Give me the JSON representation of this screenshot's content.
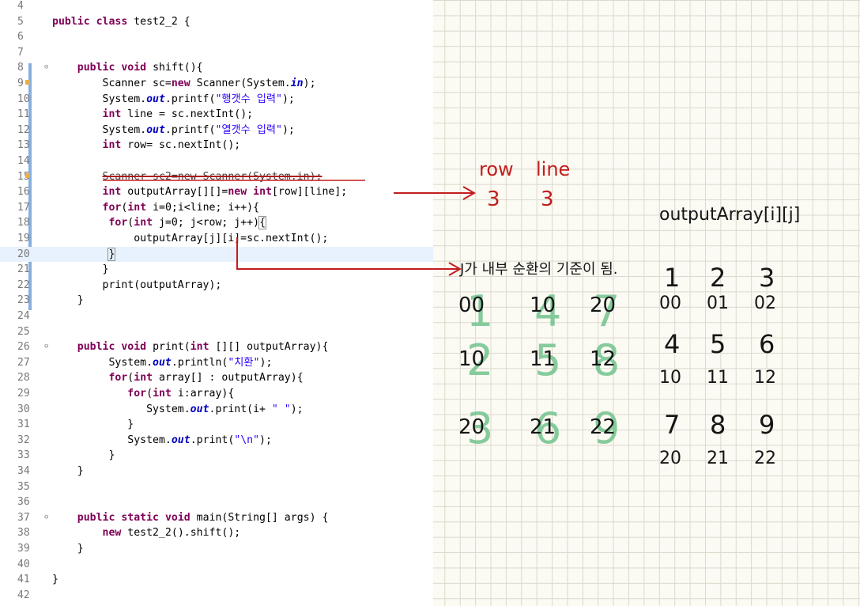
{
  "editor": {
    "lines": [
      {
        "n": "4",
        "html": ""
      },
      {
        "n": "5",
        "html": "<span class='kw'>public</span> <span class='kw'>class</span> test2_2 {"
      },
      {
        "n": "6",
        "html": ""
      },
      {
        "n": "7",
        "html": ""
      },
      {
        "n": "8",
        "marker": "⊖",
        "html": "    <span class='kw'>public</span> <span class='kw'>void</span> shift(){"
      },
      {
        "n": "9",
        "warn": true,
        "html": "        Scanner sc=<span class='kw'>new</span> Scanner(System.<span class='fld'>in</span>);"
      },
      {
        "n": "10",
        "html": "        System.<span class='fld'>out</span>.printf(<span class='str'>\"행갯수 입력\"</span>);"
      },
      {
        "n": "11",
        "html": "        <span class='kw'>int</span> line = sc.nextInt();"
      },
      {
        "n": "12",
        "html": "        System.<span class='fld'>out</span>.printf(<span class='str'>\"열갯수 입력\"</span>);"
      },
      {
        "n": "13",
        "html": "        <span class='kw'>int</span> row= sc.nextInt();"
      },
      {
        "n": "14",
        "html": ""
      },
      {
        "n": "15",
        "warn": true,
        "html": "        <span class='strike'>Scanner sc2=new Scanner(System.in);</span>"
      },
      {
        "n": "16",
        "html": "        <span class='kw'>int</span> outputArray[][]=<span class='kw'>new</span> <span class='kw'>int</span>[row][line];"
      },
      {
        "n": "17",
        "html": "        <span class='kw'>for</span>(<span class='kw'>int</span> i=0;i&lt;line; i++){"
      },
      {
        "n": "18",
        "html": "         <span class='kw'>for</span>(<span class='kw'>int</span> j=0; j&lt;row; j++)<span class='bracket'>{</span>"
      },
      {
        "n": "19",
        "html": "             outputArray[j][i]=sc.nextInt();"
      },
      {
        "n": "20",
        "current": true,
        "html": "         <span class='bracket'>}</span>"
      },
      {
        "n": "21",
        "html": "        }"
      },
      {
        "n": "22",
        "html": "        print(outputArray);"
      },
      {
        "n": "23",
        "html": "    }"
      },
      {
        "n": "24",
        "html": ""
      },
      {
        "n": "25",
        "html": ""
      },
      {
        "n": "26",
        "marker": "⊖",
        "html": "    <span class='kw'>public</span> <span class='kw'>void</span> print(<span class='kw'>int</span> [][] outputArray){"
      },
      {
        "n": "27",
        "html": "         System.<span class='fld'>out</span>.println(<span class='str'>\"치환\"</span>);"
      },
      {
        "n": "28",
        "html": "         <span class='kw'>for</span>(<span class='kw'>int</span> array[] : outputArray){"
      },
      {
        "n": "29",
        "html": "            <span class='kw'>for</span>(<span class='kw'>int</span> i:array){"
      },
      {
        "n": "30",
        "html": "               System.<span class='fld'>out</span>.print(i+ <span class='str'>\" \"</span>);"
      },
      {
        "n": "31",
        "html": "            }"
      },
      {
        "n": "32",
        "html": "            System.<span class='fld'>out</span>.print(<span class='str'>\"\\n\"</span>);"
      },
      {
        "n": "33",
        "html": "         }"
      },
      {
        "n": "34",
        "html": "    }"
      },
      {
        "n": "35",
        "html": ""
      },
      {
        "n": "36",
        "html": ""
      },
      {
        "n": "37",
        "marker": "⊖",
        "html": "    <span class='kw'>public</span> <span class='kw'>static</span> <span class='kw'>void</span> main(String[] args) {"
      },
      {
        "n": "38",
        "html": "        <span class='kw'>new</span> test2_2().shift();"
      },
      {
        "n": "39",
        "html": "    }"
      },
      {
        "n": "40",
        "html": ""
      },
      {
        "n": "41",
        "html": "}"
      },
      {
        "n": "42",
        "html": ""
      }
    ]
  },
  "notes": {
    "row_label": "row",
    "line_label": "line",
    "row_value": "3",
    "line_value": "3",
    "array_title": "outputArray[i][j]",
    "korean_note": "J가 내부 순환의 기준이 됨.",
    "left_grid": [
      [
        "00",
        "10",
        "20"
      ],
      [
        "10",
        "11",
        "12"
      ],
      [
        "20",
        "21",
        "22"
      ]
    ],
    "green_overlay": [
      [
        "1",
        "4",
        "7"
      ],
      [
        "2",
        "5",
        "8"
      ],
      [
        "3",
        "6",
        "9"
      ]
    ],
    "right_values": [
      [
        "1",
        "2",
        "3"
      ],
      [
        "4",
        "5",
        "6"
      ],
      [
        "7",
        "8",
        "9"
      ]
    ],
    "right_indices": [
      [
        "00",
        "01",
        "02"
      ],
      [
        "10",
        "11",
        "12"
      ],
      [
        "20",
        "21",
        "22"
      ]
    ],
    "ink_colors": {
      "red": "#c21d1d",
      "green": "#72c38d",
      "black": "#151515"
    }
  }
}
